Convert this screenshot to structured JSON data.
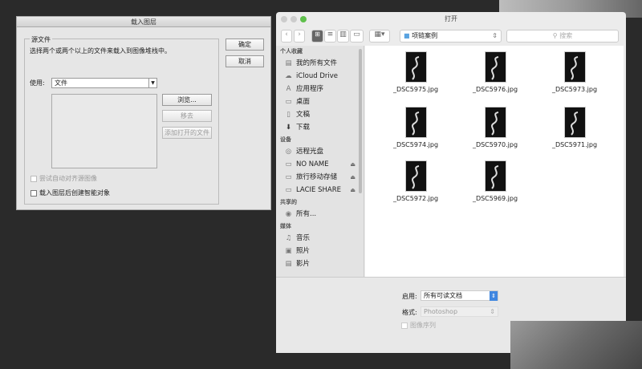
{
  "load_layers": {
    "title": "载入图层",
    "group_label": "源文件",
    "instruction": "选择两个或两个以上的文件来载入到图像堆栈中。",
    "use_label": "使用:",
    "use_value": "文件",
    "browse": "浏览...",
    "remove": "移去",
    "add_open": "添加打开的文件",
    "ok": "确定",
    "cancel": "取消",
    "auto_align": "尝试自动对齐源图像",
    "smart_object": "载入图层后创建智能对象"
  },
  "finder": {
    "title": "打开",
    "location": "项链案例",
    "search_placeholder": "搜索",
    "sidebar": {
      "favorites_header": "个人收藏",
      "favorites": [
        "我的所有文件",
        "iCloud Drive",
        "应用程序",
        "桌面",
        "文稿",
        "下载"
      ],
      "devices_header": "设备",
      "devices": [
        "远程光盘",
        "NO NAME",
        "旅行移动存储",
        "LACIE SHARE"
      ],
      "shared_header": "共享的",
      "shared": [
        "所有..."
      ],
      "media_header": "媒体",
      "media": [
        "音乐",
        "照片",
        "影片"
      ]
    },
    "files": [
      "_DSC5975.jpg",
      "_DSC5976.jpg",
      "_DSC5973.jpg",
      "_DSC5974.jpg",
      "_DSC5970.jpg",
      "_DSC5971.jpg",
      "_DSC5972.jpg",
      "_DSC5969.jpg"
    ],
    "enable_label": "启用:",
    "enable_value": "所有可读文档",
    "format_label": "格式:",
    "format_value": "Photoshop",
    "sequence_label": "图像序列"
  }
}
